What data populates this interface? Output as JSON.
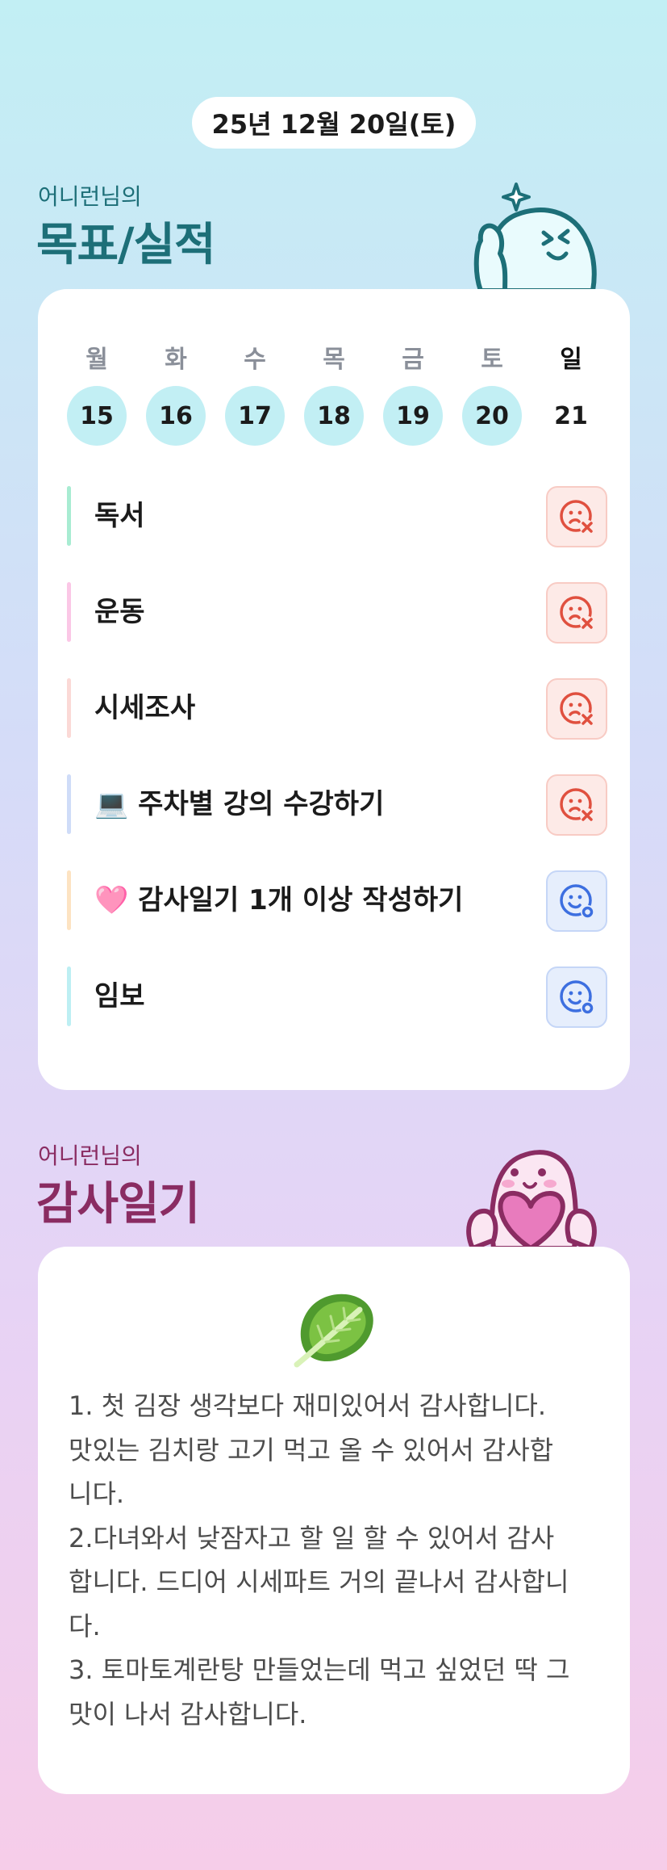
{
  "date_label": "25년 12월 20일(토)",
  "goals_section": {
    "subtitle": "어니런님의",
    "title": "목표/실적"
  },
  "week": [
    {
      "weekday": "월",
      "day": "15"
    },
    {
      "weekday": "화",
      "day": "16"
    },
    {
      "weekday": "수",
      "day": "17"
    },
    {
      "weekday": "목",
      "day": "18"
    },
    {
      "weekday": "금",
      "day": "19"
    },
    {
      "weekday": "토",
      "day": "20"
    },
    {
      "weekday": "일",
      "day": "21"
    }
  ],
  "goals": [
    {
      "label": "독서",
      "status": "fail",
      "bar_color": "#a8ecd2"
    },
    {
      "label": "운동",
      "status": "fail",
      "bar_color": "#fbc7e6"
    },
    {
      "label": "시세조사",
      "status": "fail",
      "bar_color": "#fbd9d6"
    },
    {
      "label": "💻 주차별 강의 수강하기",
      "status": "fail",
      "bar_color": "#cfdcf8"
    },
    {
      "label": "🩷 감사일기 1개 이상 작성하기",
      "status": "done",
      "bar_color": "#fde3c2"
    },
    {
      "label": "임보",
      "status": "done",
      "bar_color": "#bdeff3"
    }
  ],
  "gratitude_section": {
    "subtitle": "어니런님의",
    "title": "감사일기"
  },
  "gratitude_icon": "leafy-greens-icon",
  "gratitude_text": "1. 첫 김장 생각보다 재미있어서 감사합니다.\n맛있는 김치랑 고기 먹고 올 수 있어서 감사합\n니다.\n2.다녀와서 낮잠자고 할 일 할 수 있어서 감사\n합니다. 드디어 시세파트 거의 끝나서 감사합니\n다.\n3. 토마토계란탕 만들었는데 먹고 싶었던 딱 그\n맛이 나서 감사합니다.",
  "colors": {
    "goals_title": "#1d6f78",
    "gratitude_title": "#8a2c62",
    "fail_icon": "#e0503f",
    "done_icon": "#3d6fe0"
  }
}
